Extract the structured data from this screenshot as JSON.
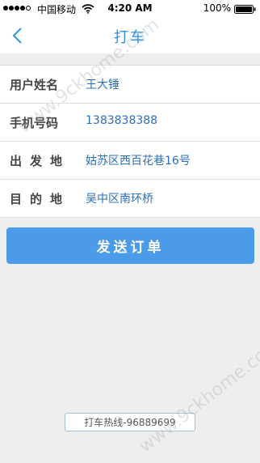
{
  "status_bar": {
    "carrier": "中国移动",
    "time": "4:20 AM",
    "battery": "100%"
  },
  "nav": {
    "title": "打车",
    "back_icon": "chevron-left-icon",
    "accent_color": "#2f8fde"
  },
  "form": {
    "rows": [
      {
        "label": "用户姓名",
        "value": "王大锤"
      },
      {
        "label": "手机号码",
        "value": "1383838388"
      },
      {
        "label": "出发地",
        "value": "姑苏区西百花巷16号"
      },
      {
        "label": "目的地",
        "value": "吴中区南环桥"
      }
    ]
  },
  "submit": {
    "label": "发送订单",
    "color": "#4c9be9"
  },
  "hotline": {
    "label": "打车热线-96889699"
  },
  "watermark": {
    "text": "www.9ckhome.com"
  }
}
